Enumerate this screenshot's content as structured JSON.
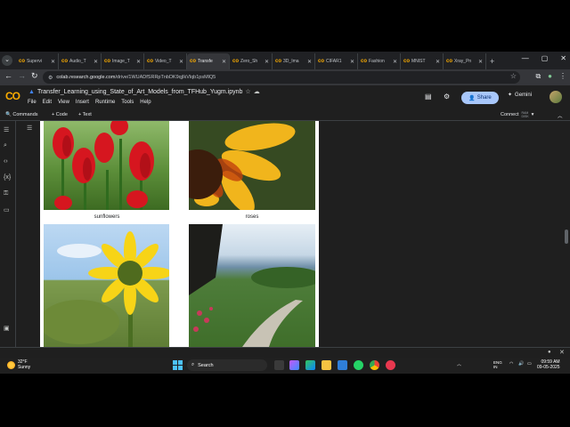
{
  "browser": {
    "tabs": [
      {
        "label": "Supervi",
        "active": false
      },
      {
        "label": "Audio_T",
        "active": false
      },
      {
        "label": "Image_T",
        "active": false
      },
      {
        "label": "Video_T",
        "active": false
      },
      {
        "label": "Transfe",
        "active": true
      },
      {
        "label": "Zero_Sh",
        "active": false
      },
      {
        "label": "3D_Ima",
        "active": false
      },
      {
        "label": "CIFAR1",
        "active": false
      },
      {
        "label": "Fashion",
        "active": false
      },
      {
        "label": "MNIST",
        "active": false
      },
      {
        "label": "Xray_Pn",
        "active": false
      }
    ],
    "url_host": "colab.research.google.com",
    "url_path": "/drive/1WUADfSRRpTnbDK9qjIkVlqb1psMlQ5"
  },
  "colab": {
    "notebook_title": "Transfer_Learning_using_State_of_Art_Models_from_TFHub_Yugm.ipynb",
    "menus": [
      "File",
      "Edit",
      "View",
      "Insert",
      "Runtime",
      "Tools",
      "Help"
    ],
    "share_label": "Share",
    "gemini_label": "Gemini",
    "toolbar": {
      "commands": "Commands",
      "add_code": "+ Code",
      "add_text": "+ Text",
      "connect": "Connect",
      "ram_label": "RAM",
      "disk_label": "DISK"
    }
  },
  "output": {
    "captions": [
      "sunflowers",
      "roses"
    ]
  },
  "taskbar": {
    "weather_temp": "32°F",
    "weather_desc": "Sunny",
    "search_placeholder": "Search",
    "lang_top": "ENG",
    "lang_bottom": "IN",
    "time": "09:59 AM",
    "date": "09-05-2025"
  }
}
